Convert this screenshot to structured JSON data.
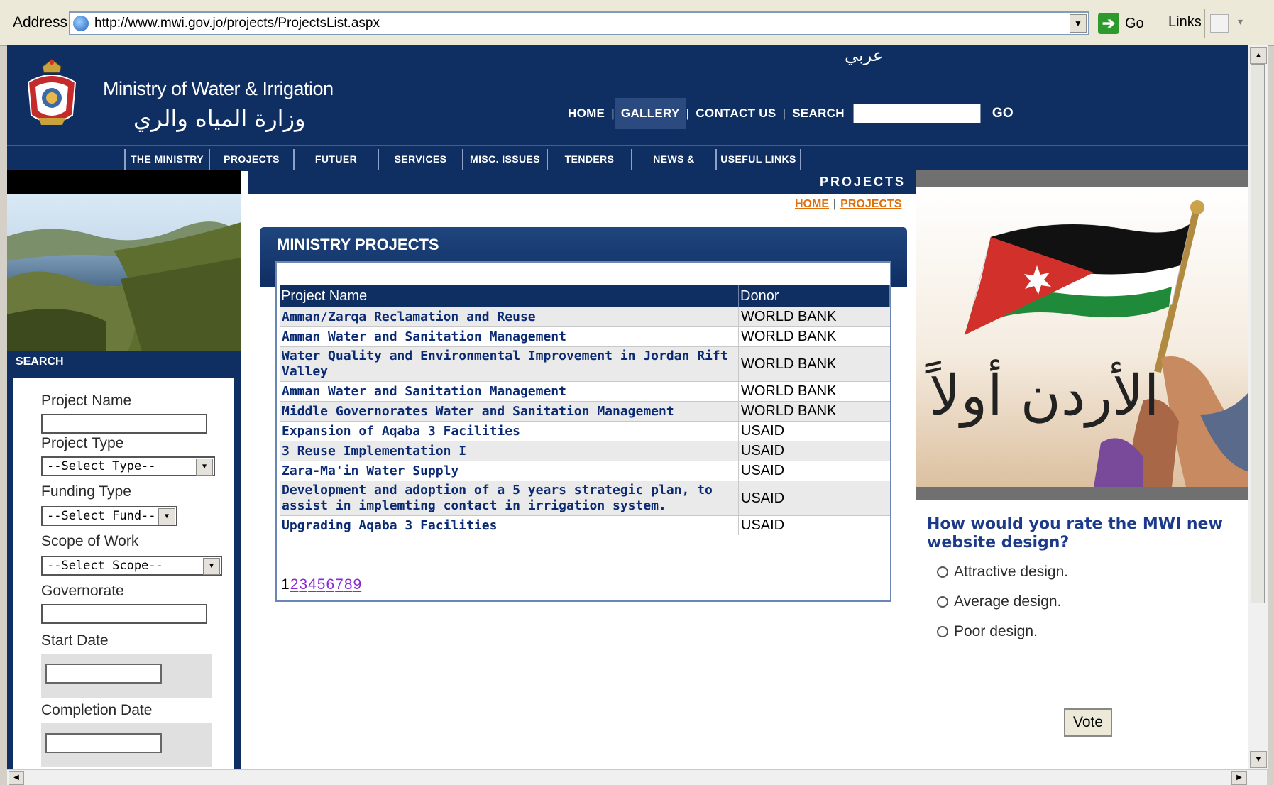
{
  "browser": {
    "address_label": "Address",
    "url": "http://www.mwi.gov.jo/projects/ProjectsList.aspx",
    "go_label": "Go",
    "links_label": "Links"
  },
  "header": {
    "arabic_link": "عربي",
    "brand_en": "Ministry of Water & Irrigation",
    "brand_ar": "وزارة المياه والري",
    "nav": {
      "home": "HOME",
      "gallery": "GALLERY",
      "contact": "CONTACT US",
      "search": "SEARCH",
      "go": "GO"
    },
    "main_nav": [
      "THE MINISTRY",
      "PROJECTS",
      "FUTUER PROJECTS",
      "SERVICES",
      "MISC. ISSUES",
      "TENDERS",
      "NEWS & EVENTS",
      "USEFUL LINKS"
    ]
  },
  "section_bar": "PROJECTS",
  "breadcrumb": {
    "home": "HOME",
    "sep": "|",
    "current": "PROJECTS"
  },
  "left": {
    "search_title": "SEARCH",
    "fields": {
      "project_name": "Project Name",
      "project_type": "Project Type",
      "project_type_value": "--Select Type--",
      "funding_type": "Funding Type",
      "funding_type_value": "--Select Fund--",
      "scope": "Scope of Work",
      "scope_value": "--Select Scope--",
      "governorate": "Governorate",
      "start_date": "Start Date",
      "completion_date": "Completion Date"
    }
  },
  "panel": {
    "title": "MINISTRY PROJECTS",
    "columns": [
      "Project Name",
      "Donor"
    ],
    "rows": [
      {
        "name": "Amman/Zarqa Reclamation and Reuse",
        "donor": "WORLD BANK"
      },
      {
        "name": "Amman Water and Sanitation Management",
        "donor": "WORLD BANK"
      },
      {
        "name": "Water Quality and Environmental Improvement in Jordan Rift Valley",
        "donor": "WORLD BANK"
      },
      {
        "name": "Amman Water and Sanitation Management",
        "donor": "WORLD BANK"
      },
      {
        "name": "Middle Governorates Water and Sanitation Management",
        "donor": "WORLD BANK"
      },
      {
        "name": "Expansion of Aqaba 3 Facilities",
        "donor": "USAID"
      },
      {
        "name": "3 Reuse Implementation I",
        "donor": "USAID"
      },
      {
        "name": "Zara-Ma'in Water Supply",
        "donor": "USAID"
      },
      {
        "name": "Development and adoption of a 5 years strategic plan, to assist in implemting contact in irrigation system.",
        "donor": "USAID"
      },
      {
        "name": "Upgrading Aqaba 3 Facilities",
        "donor": "USAID"
      }
    ],
    "pager": {
      "current": "1",
      "pages": [
        "2",
        "3",
        "4",
        "5",
        "6",
        "7",
        "8",
        "9"
      ]
    }
  },
  "poll": {
    "question": "How would you rate the MWI new website design?",
    "options": [
      "Attractive design.",
      "Average design.",
      "Poor design."
    ],
    "vote": "Vote"
  },
  "banner_text": "الأردن أولاً",
  "colors": {
    "navy": "#0f2e62",
    "link_orange": "#e06e0a",
    "project_text": "#0a2a73",
    "poll_text": "#1b3a8a"
  }
}
